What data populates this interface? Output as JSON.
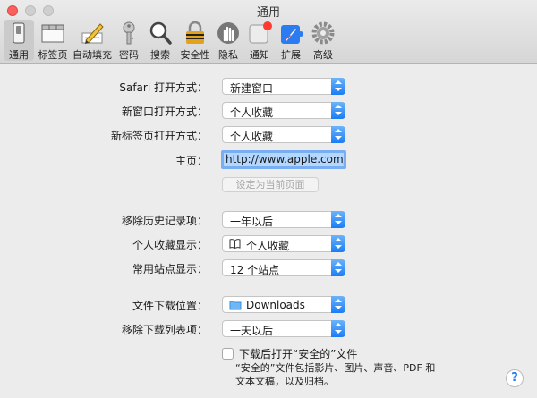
{
  "window": {
    "title": "通用"
  },
  "toolbar": [
    {
      "id": "general",
      "label": "通用",
      "icon": "general-switch-icon"
    },
    {
      "id": "tabs",
      "label": "标签页",
      "icon": "tabs-window-icon"
    },
    {
      "id": "autofill",
      "label": "自动填充",
      "icon": "pencil-form-icon"
    },
    {
      "id": "passwords",
      "label": "密码",
      "icon": "key-icon"
    },
    {
      "id": "search",
      "label": "搜索",
      "icon": "magnifier-icon"
    },
    {
      "id": "security",
      "label": "安全性",
      "icon": "lock-icon"
    },
    {
      "id": "privacy",
      "label": "隐私",
      "icon": "hand-icon"
    },
    {
      "id": "notifications",
      "label": "通知",
      "icon": "notification-badge-icon"
    },
    {
      "id": "extensions",
      "label": "扩展",
      "icon": "puzzle-icon"
    },
    {
      "id": "advanced",
      "label": "高级",
      "icon": "gear-icon"
    }
  ],
  "form": {
    "safari_open": {
      "label": "Safari 打开方式：",
      "value": "新建窗口"
    },
    "new_window": {
      "label": "新窗口打开方式：",
      "value": "个人收藏"
    },
    "new_tab": {
      "label": "新标签页打开方式：",
      "value": "个人收藏"
    },
    "homepage": {
      "label": "主页：",
      "value": "http://www.apple.com/cn/"
    },
    "set_current": "设定为当前页面",
    "remove_history": {
      "label": "移除历史记录项：",
      "value": "一年以后"
    },
    "favorites_show": {
      "label": "个人收藏显示：",
      "value": "个人收藏",
      "icon": "book-icon"
    },
    "top_sites": {
      "label": "常用站点显示：",
      "value": "12 个站点"
    },
    "download_location": {
      "label": "文件下载位置：",
      "value": "Downloads",
      "icon": "folder-icon"
    },
    "remove_downloads": {
      "label": "移除下载列表项：",
      "value": "一天以后"
    },
    "open_safe": {
      "label": "下载后打开“安全的”文件",
      "checked": false
    },
    "safe_hint": "“安全的”文件包括影片、图片、声音、PDF 和文本文稿，以及归档。"
  },
  "help": "?",
  "colors": {
    "accent": "#1a7df5",
    "selection": "#b3d7ff"
  }
}
